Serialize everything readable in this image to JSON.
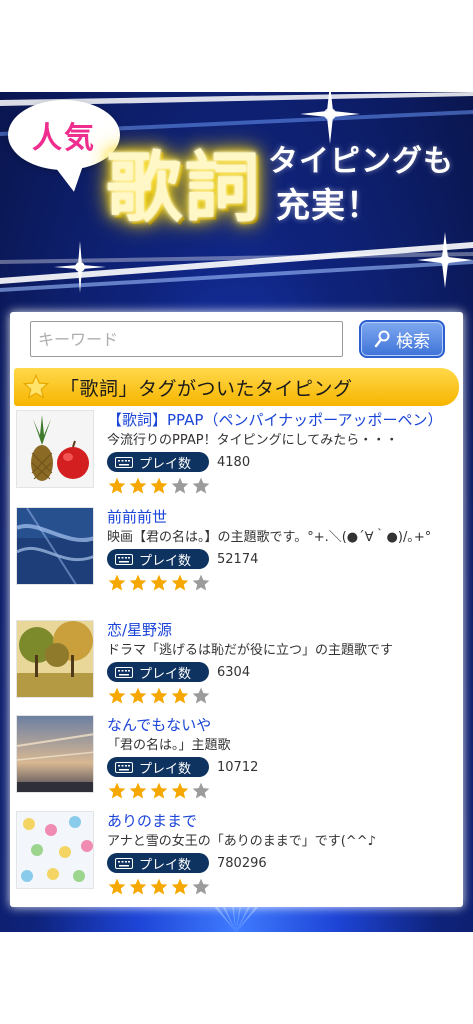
{
  "banner": {
    "bubble_text": "人気",
    "main_title": "歌詞",
    "sub_line1": "タイピングも",
    "sub_line2": "充実！"
  },
  "search": {
    "placeholder": "キーワード",
    "value": "",
    "button_label": "検索",
    "button_icon": "search-icon"
  },
  "section": {
    "title": "「歌詞」タグがついたタイピング",
    "icon": "star-icon"
  },
  "play_label": "プレイ数",
  "colors": {
    "link": "#1b45d8",
    "badge": "#0f3360",
    "star_on": "#f6a800",
    "star_off": "#9b9b9b",
    "section_bar": "#fcc824",
    "pink": "#ee2d8e"
  },
  "items": [
    {
      "title": "【歌詞】PPAP（ペンパイナッポーアッポーペン）",
      "desc": "今流行りのPPAP！タイピングにしてみたら・・・",
      "plays": "4180",
      "rating": 3,
      "thumb": "pineapple-apple-photo"
    },
    {
      "title": "前前前世",
      "desc": "映画【君の名は。】の主題歌です。°+.＼(●´∀｀●)/｡+°",
      "plays": "52174",
      "rating": 4,
      "thumb": "blue-sky-photo"
    },
    {
      "title": "恋/星野源",
      "desc": "ドラマ「逃げるは恥だが役に立つ」の主題歌です",
      "plays": "6304",
      "rating": 4,
      "thumb": "autumn-trees-photo"
    },
    {
      "title": "なんでもないや",
      "desc": "「君の名は。」主題歌",
      "plays": "10712",
      "rating": 4,
      "thumb": "sunset-sky-photo"
    },
    {
      "title": "ありのままで",
      "desc": "アナと雪の女王の「ありのままで」です(^^♪",
      "plays": "780296",
      "rating": 4,
      "thumb": "pastel-pattern-photo"
    }
  ]
}
